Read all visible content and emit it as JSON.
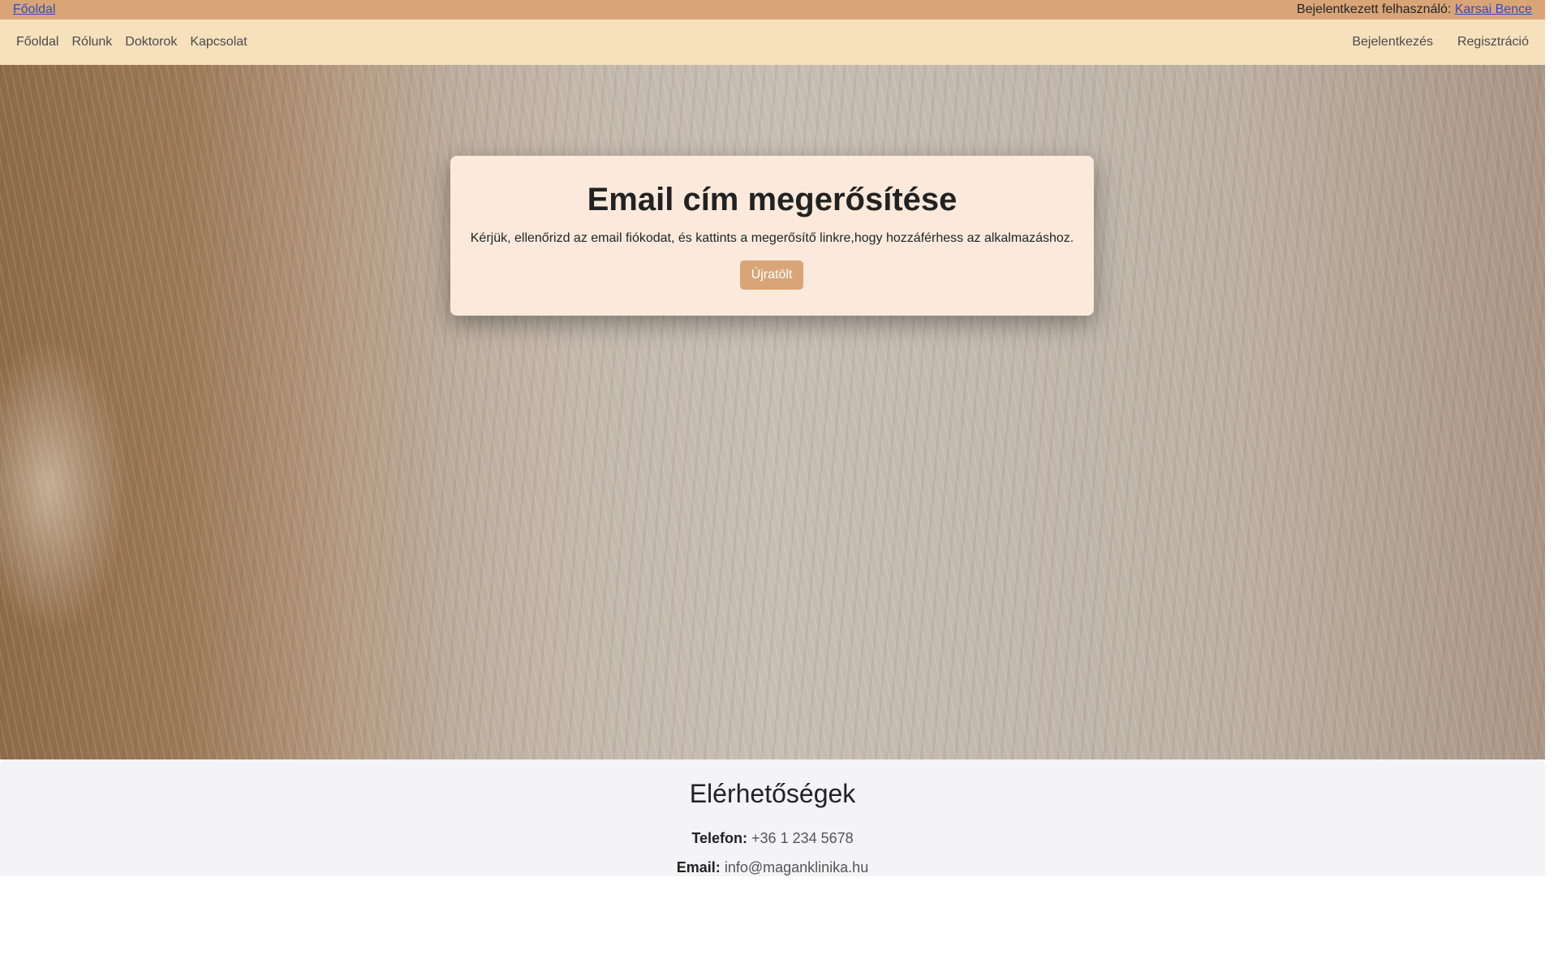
{
  "topbar": {
    "home_link": "Főoldal",
    "user_prefix": "Bejelentkezett felhasználó:",
    "user_name": "Karsai Bence"
  },
  "navbar": {
    "left_items": [
      "Főoldal",
      "Rólunk",
      "Doktorok",
      "Kapcsolat"
    ],
    "right_items": [
      "Bejelentkezés",
      "Regisztráció"
    ]
  },
  "verify_card": {
    "title": "Email cím megerősítése",
    "message": "Kérjük, ellenőrizd az email fiókodat, és kattints a megerősítő linkre,hogy hozzáférhess az alkalmazáshoz.",
    "button_label": "Újratölt"
  },
  "contact": {
    "title": "Elérhetőségek",
    "phone_label": "Telefon:",
    "phone_value": "+36 1 234 5678",
    "email_label": "Email:",
    "email_value": "info@maganklinika.hu"
  },
  "colors": {
    "topbar_bg": "#d9a577",
    "navbar_bg": "#f7e1bd",
    "card_bg": "#fbeadb",
    "button_bg": "#d9a577",
    "link": "#2b4cc9",
    "footer_bg": "#f4f4f7"
  },
  "icons": {
    "scroll_down": "chevron-down-icon"
  }
}
